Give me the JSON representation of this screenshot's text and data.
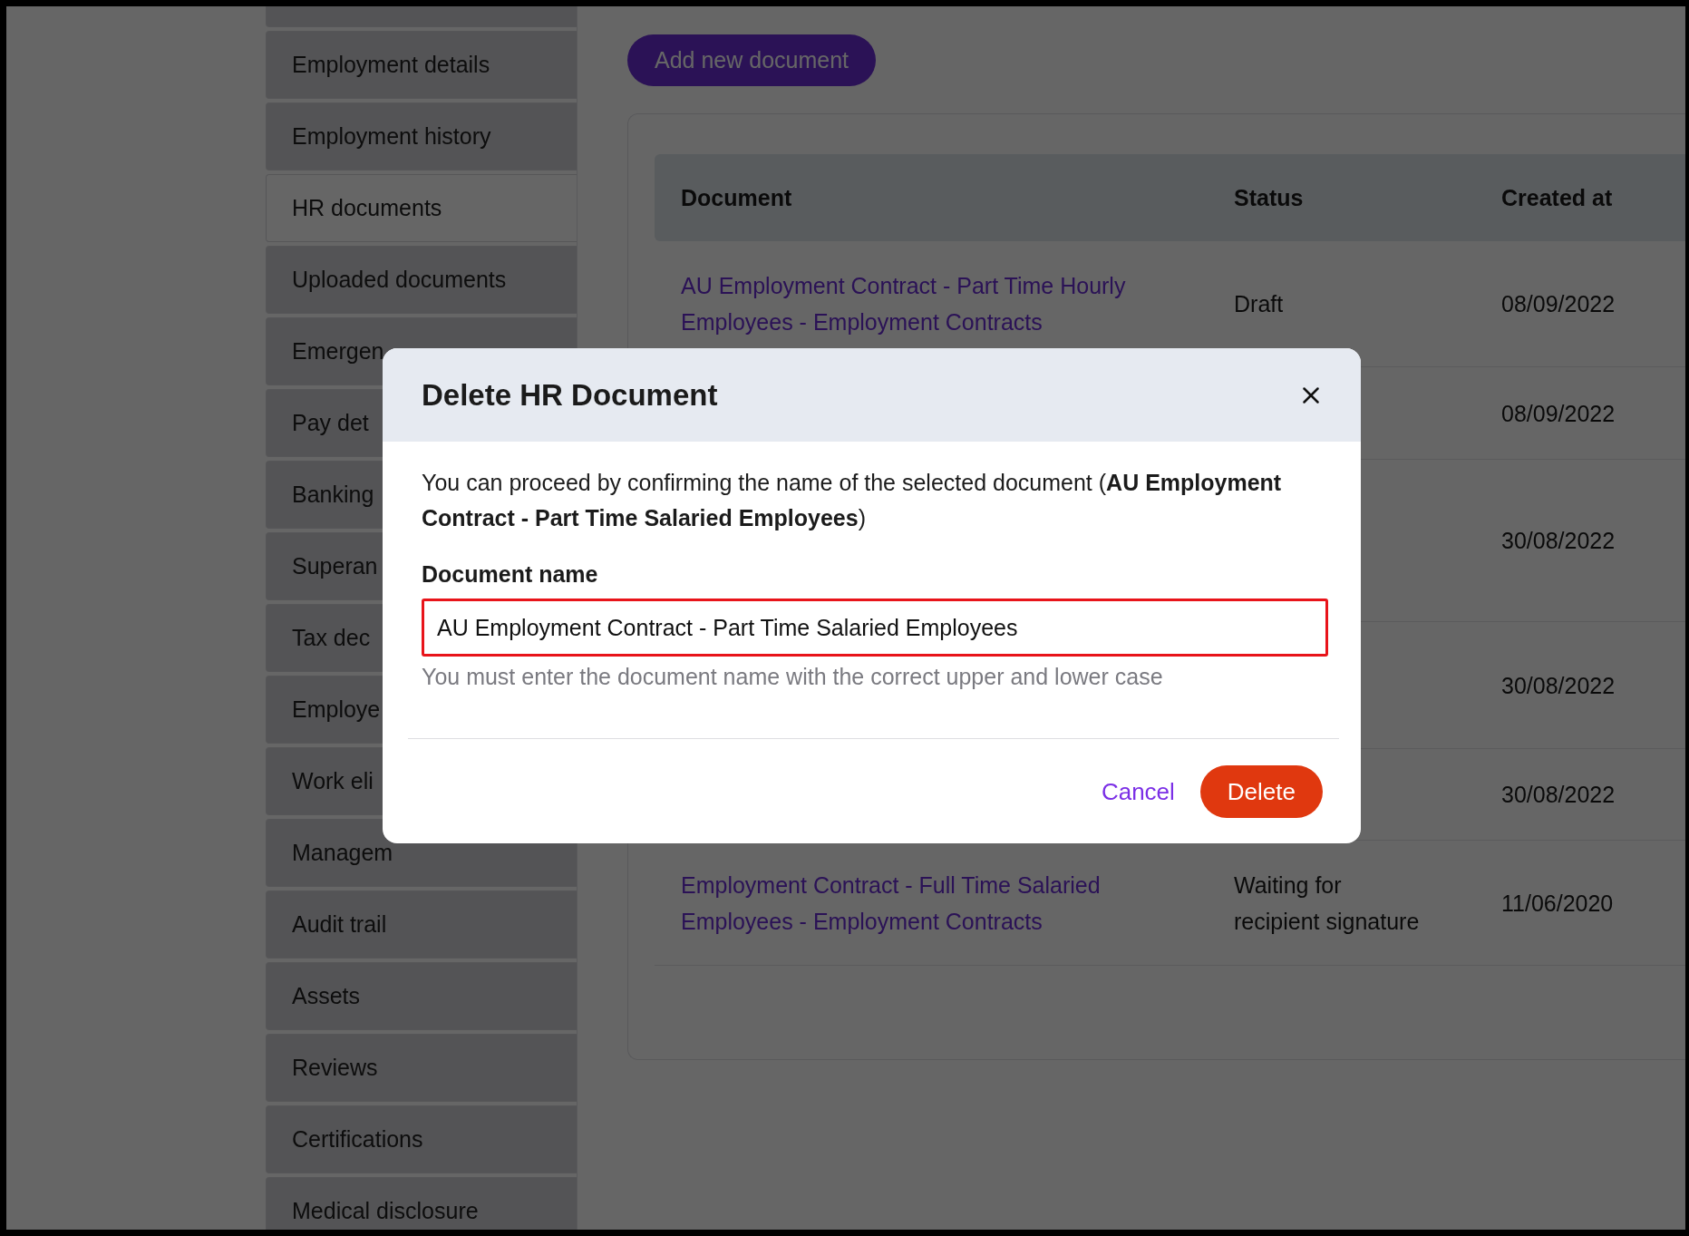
{
  "sidebar": {
    "items": [
      {
        "label": "Employment details",
        "selected": false
      },
      {
        "label": "Employment history",
        "selected": false
      },
      {
        "label": "HR documents",
        "selected": true
      },
      {
        "label": "Uploaded documents",
        "selected": false
      },
      {
        "label": "Emergen",
        "selected": false
      },
      {
        "label": "Pay det",
        "selected": false
      },
      {
        "label": "Banking",
        "selected": false
      },
      {
        "label": "Superan",
        "selected": false
      },
      {
        "label": "Tax dec",
        "selected": false
      },
      {
        "label": "Employe",
        "selected": false
      },
      {
        "label": "Work eli",
        "selected": false
      },
      {
        "label": "Managem",
        "selected": false
      },
      {
        "label": "Audit trail",
        "selected": false
      },
      {
        "label": "Assets",
        "selected": false
      },
      {
        "label": "Reviews",
        "selected": false
      },
      {
        "label": "Certifications",
        "selected": false
      },
      {
        "label": "Medical disclosure",
        "selected": false
      }
    ]
  },
  "add_button": "Add new document",
  "table": {
    "columns": [
      "Document",
      "Status",
      "Created at"
    ],
    "rows": [
      {
        "document": "AU Employment Contract - Part Time Hourly Employees - Employment Contracts",
        "status": "Draft",
        "created_at": "08/09/2022"
      },
      {
        "created_at": "08/09/2022"
      },
      {
        "created_at": "30/08/2022"
      },
      {
        "created_at": "30/08/2022"
      },
      {
        "created_at": "30/08/2022"
      },
      {
        "document": "Employment Contract - Full Time Salaried Employees - Employment Contracts",
        "status": "Waiting for recipient signature",
        "created_at": "11/06/2020"
      }
    ]
  },
  "dialog": {
    "title": "Delete HR Document",
    "message": "You can proceed by confirming the name of the selected document (**AU Employment Contract - Part Time Salaried Employees**)",
    "field_label": "Document name",
    "field_value": "AU Employment Contract - Part Time Salaried Employees",
    "invalid": true,
    "hint": "You must enter the document name with the correct upper and lower case",
    "buttons": {
      "cancel": "Cancel",
      "confirm": "Delete"
    }
  }
}
